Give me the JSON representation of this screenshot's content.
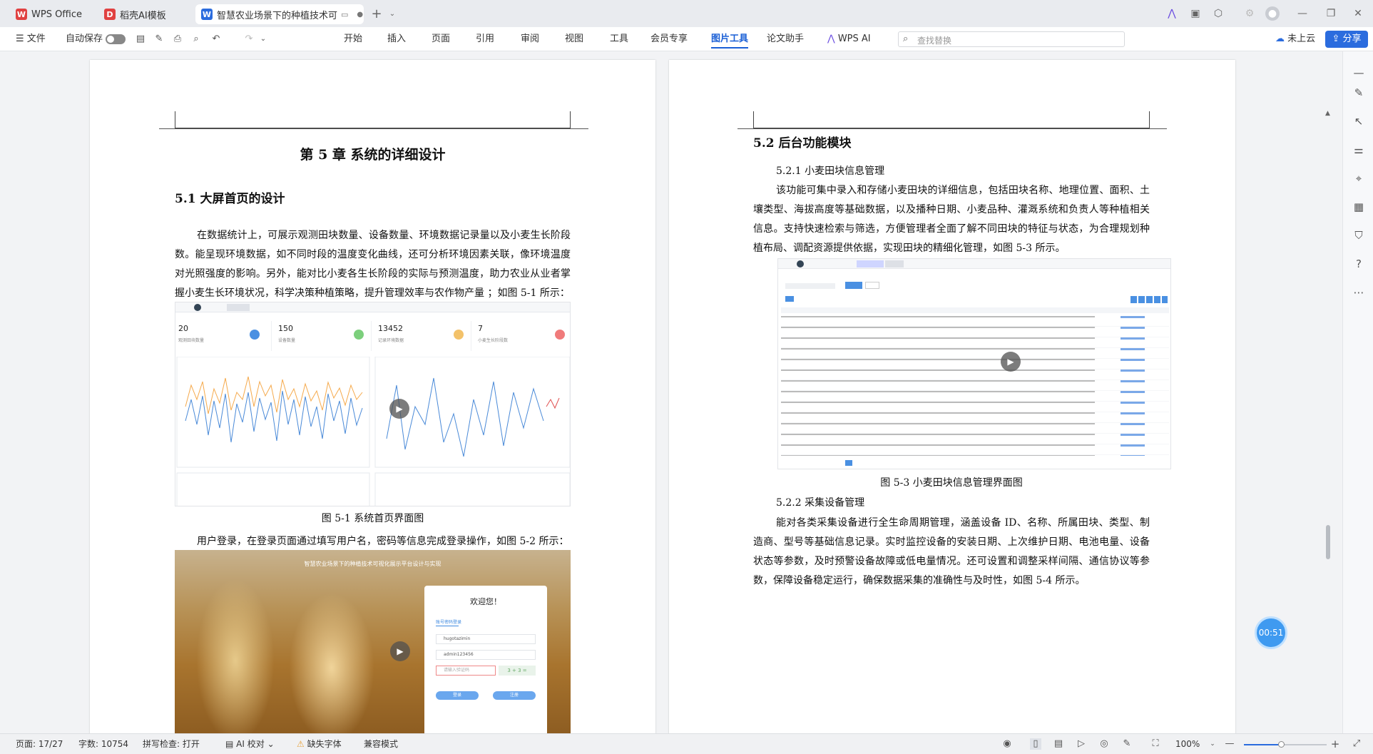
{
  "tabs": [
    {
      "label": "WPS Office",
      "icon": "wps-logo-icon",
      "color": "#e04141"
    },
    {
      "label": "稻壳AI模板",
      "icon": "docer-logo-icon",
      "color": "#e04141"
    },
    {
      "label": "智慧农业场景下的种植技术可",
      "icon": "word-doc-icon",
      "color": "#2b6cde"
    }
  ],
  "ribbon": {
    "file_label": "文件",
    "autosave_label": "自动保存",
    "menus": [
      "开始",
      "插入",
      "页面",
      "引用",
      "审阅",
      "视图",
      "工具",
      "会员专享",
      "图片工具",
      "论文助手",
      "WPS AI"
    ],
    "active_menu": "图片工具",
    "search_placeholder": "查找替换",
    "cloud_label": "未上云",
    "share_label": "分享"
  },
  "left_page": {
    "chapter_title": "第 5 章  系统的详细设计",
    "section_title": "5.1 大屏首页的设计",
    "paragraph1": "在数据统计上，可展示观测田块数量、设备数量、环境数据记录量以及小麦生长阶段数。能呈现环境数据，如不同时段的温度变化曲线，还可分析环境因素关联，像环境温度对光照强度的影响。另外，能对比小麦各生长阶段的实际与预测温度，助力农业从业者掌握小麦生长环境状况，科学决策种植策略，提升管理效率与农作物产量 ；如图 5-1 所示：",
    "stats": [
      {
        "value": "20",
        "label": "观测田块数量"
      },
      {
        "value": "150",
        "label": "设备数量"
      },
      {
        "value": "13452",
        "label": "记录环境数据"
      },
      {
        "value": "7",
        "label": "小麦生长阶段数"
      }
    ],
    "figure1_caption": "图 5-1 系统首页界面图",
    "paragraph2": "用户登录，在登录页面通过填写用户名，密码等信息完成登录操作，如图 5-2 所示：",
    "login": {
      "banner": "智慧农业场景下的种植技术可视化展示平台设计与实现",
      "welcome": "欢迎您！",
      "tab": "账号密码登录",
      "username": "hugotazimin",
      "password": "admin123456",
      "captcha_placeholder": "请输入验证码",
      "captcha": "3 + 3 =",
      "login_btn": "登录",
      "register_btn": "注册"
    }
  },
  "right_page": {
    "section_title": "5.2 后台功能模块",
    "sub1": "5.2.1 小麦田块信息管理",
    "para1": "该功能可集中录入和存储小麦田块的详细信息，包括田块名称、地理位置、面积、土壤类型、海拔高度等基础数据，以及播种日期、小麦品种、灌溉系统和负责人等种植相关信息。支持快速检索与筛选，方便管理者全面了解不同田块的特征与状态，为合理规划种植布局、调配资源提供依据，实现田块的精细化管理，如图 5-3 所示。",
    "figure3_caption": "图 5-3 小麦田块信息管理界面图",
    "sub2": "5.2.2 采集设备管理",
    "para2": "能对各类采集设备进行全生命周期管理，涵盖设备 ID、名称、所属田块、类型、制造商、型号等基础信息记录。实时监控设备的安装日期、上次维护日期、电池电量、设备状态等参数，及时预警设备故障或低电量情况。还可设置和调整采样间隔、通信协议等参数，保障设备稳定运行，确保数据采集的准确性与及时性，如图 5-4 所示。"
  },
  "timer": "00:51",
  "status": {
    "page": "页面: 17/27",
    "words": "字数: 10754",
    "spell": "拼写检查: 打开",
    "ai_check": "AI 校对",
    "missing_font": "缺失字体",
    "compat": "兼容模式",
    "zoom": "100%"
  },
  "colors": {
    "accent": "#1a5fd6",
    "share": "#2b6cde",
    "timer": "#3f9af0"
  }
}
